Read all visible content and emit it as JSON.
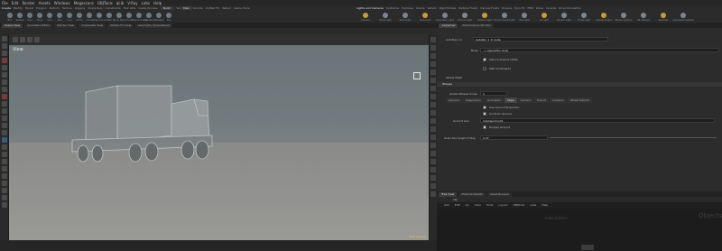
{
  "menubar": [
    "File",
    "Edit",
    "Render",
    "Assets",
    "Windows",
    "Megascans",
    "OBJTools",
    "qLib",
    "V-Ray",
    "Labs",
    "Help"
  ],
  "desktop": "Build",
  "context": "Main",
  "shelf": {
    "left_tabs": [
      "Create",
      "Modify",
      "Model",
      "Polygon",
      "Deform",
      "Texture",
      "Rigging",
      "Characters",
      "Constraints",
      "Hair Utils",
      "Guide Process",
      "Terrain FX",
      "Simple FX",
      "Volume",
      "Unified FX",
      "Vellum",
      "Game Tools"
    ],
    "right_tabs": [
      "Lights and Cameras",
      "Collisions",
      "Particles",
      "Grains",
      "Vellum",
      "Rigid Bodies",
      "Particle Fluids",
      "Viscous Fluids",
      "Oceans",
      "Pyro FX",
      "FEM",
      "Wires",
      "Crowds",
      "Drive Simulation"
    ],
    "left_tools": [
      "Box",
      "Sphere",
      "Tube",
      "Torus",
      "Grid",
      "Null",
      "Line",
      "Circle",
      "Curve",
      "Draw Curve",
      "Path",
      "Spray Paint",
      "Font",
      "Platonic Solids",
      "L-System",
      "Metaball",
      "File"
    ],
    "right_tools": [
      "Camera",
      "Point Light",
      "Spot Light",
      "Area Light",
      "Geometry Light",
      "Volume Light",
      "Distant Light",
      "Environment Light",
      "Sky Light",
      "GI Light",
      "Caustic Light",
      "Portal Light",
      "Ambient Light",
      "Stereo Camera",
      "VR Camera",
      "Switcher",
      "Gamepad Camera"
    ]
  },
  "viewport_tabs": [
    "Scene View",
    "Animation Editor",
    "Render View",
    "Composite View",
    "Motion FX View",
    "Geometry Spreadsheet"
  ],
  "viewport": {
    "title": "View",
    "bottom_label": "Auto Update",
    "persp": "Persp",
    "cam": "No cam"
  },
  "params_tabs": [
    "/obj/wheel",
    "Performance Monitor"
  ],
  "params": {
    "node_type": "AutoRig 1.0",
    "node_name": "AutoRig_1_0_node",
    "body_label": "Body",
    "body_value": "../../geo1/Fan_body",
    "checkboxes": [
      {
        "label": "SOLs to Export (SOP)",
        "checked": true
      },
      {
        "label": "SOP Constraints",
        "checked": false
      }
    ],
    "wheel_mesh_label": "Wheel Mesh",
    "section": "Wheels",
    "global_wheels_scale_label": "Global Wheels Scale",
    "global_wheels_scale_value": "1",
    "subtabs": [
      "General",
      "Suspension",
      "Animation",
      "Clips",
      "Camera",
      "Export",
      "Collision",
      "Wheel Deform"
    ],
    "active_subtab": "Clips",
    "clips_checks": [
      {
        "label": "Use Ground Projection",
        "checked": true
      },
      {
        "label": "Conform Ground",
        "checked": true
      }
    ],
    "ground_geo_label": "Ground Geo",
    "ground_geo_value": "/obj/geo1/null1",
    "display_ground": "Display Ground",
    "scale_label": "Scale the length of Ray",
    "scale_value": "0.47"
  },
  "network": {
    "tabs": [
      "Tree View",
      "Material Palette",
      "Asset Browser"
    ],
    "path": "obj",
    "menu": [
      "Add",
      "Edit",
      "Go",
      "View",
      "Tools",
      "Layout",
      "OBJTools",
      "Labs",
      "Help"
    ],
    "overlay_a": "Indie Edition",
    "overlay_b": "Objects"
  },
  "colors": {
    "accent": "#e3c85a",
    "panel": "#2c2c2c",
    "field": "#1e1e1e"
  }
}
